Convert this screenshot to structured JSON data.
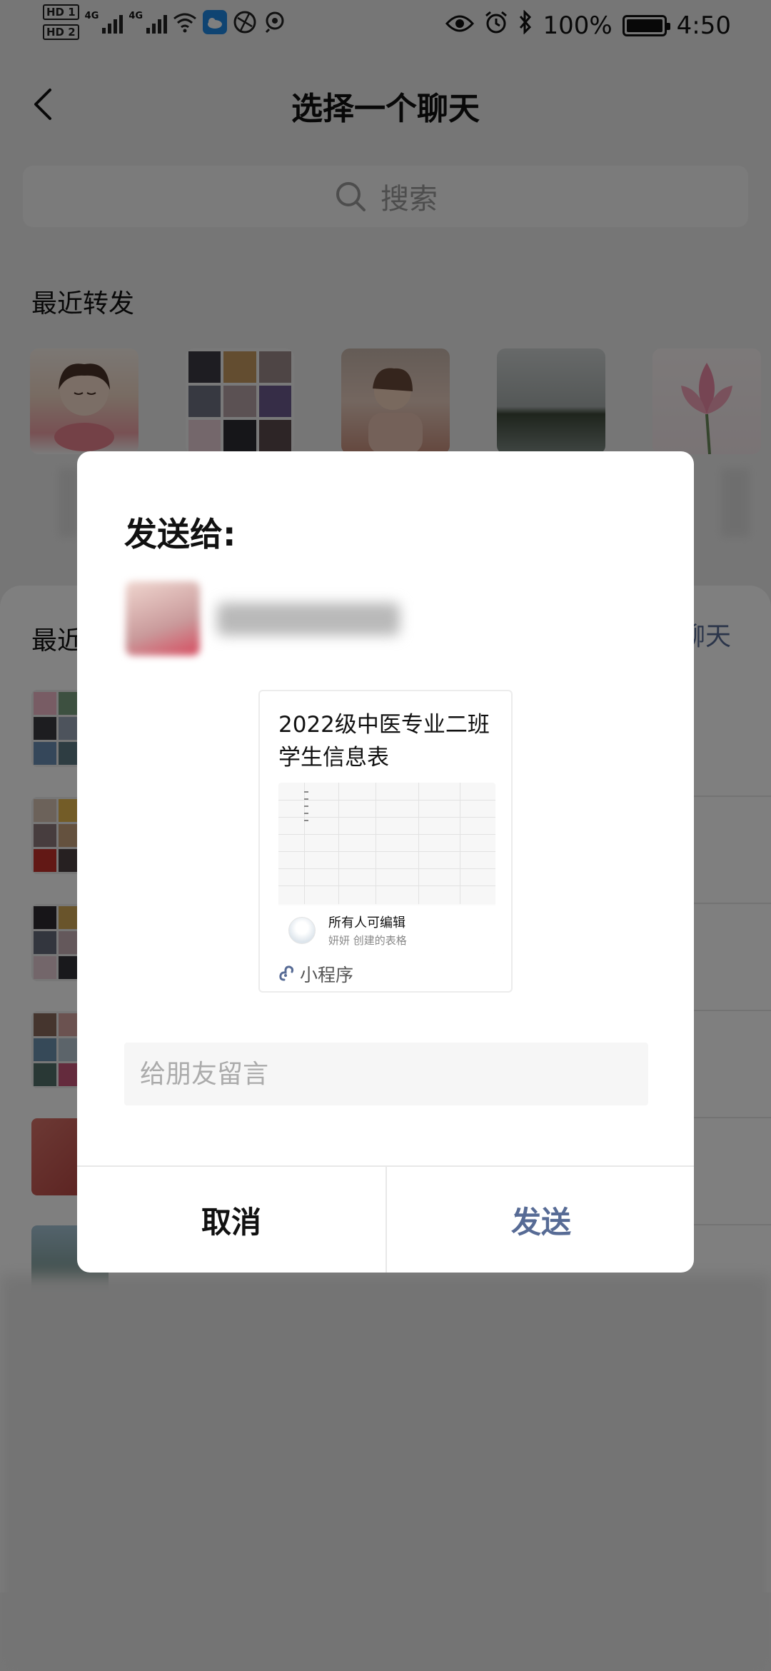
{
  "status_bar": {
    "sim1": "HD 1",
    "sim2": "HD 2",
    "network1": "4G",
    "network2": "4G",
    "battery_percent": "100%",
    "time": "4:50"
  },
  "header": {
    "title": "选择一个聊天"
  },
  "search": {
    "placeholder": "搜索"
  },
  "recent_forward": {
    "title": "最近转发"
  },
  "recent_chats": {
    "title": "最近",
    "create_link": "聊天"
  },
  "dialog": {
    "title": "发送给:",
    "card": {
      "title": "2022级中医专业二班学生信息表",
      "permission": "所有人可编辑",
      "creator": "妍妍 创建的表格",
      "type_label": "小程序"
    },
    "message_placeholder": "给朋友留言",
    "cancel_label": "取消",
    "send_label": "发送"
  },
  "colors": {
    "accent": "#576b95",
    "overlay": "rgba(0,0,0,0.5)"
  }
}
